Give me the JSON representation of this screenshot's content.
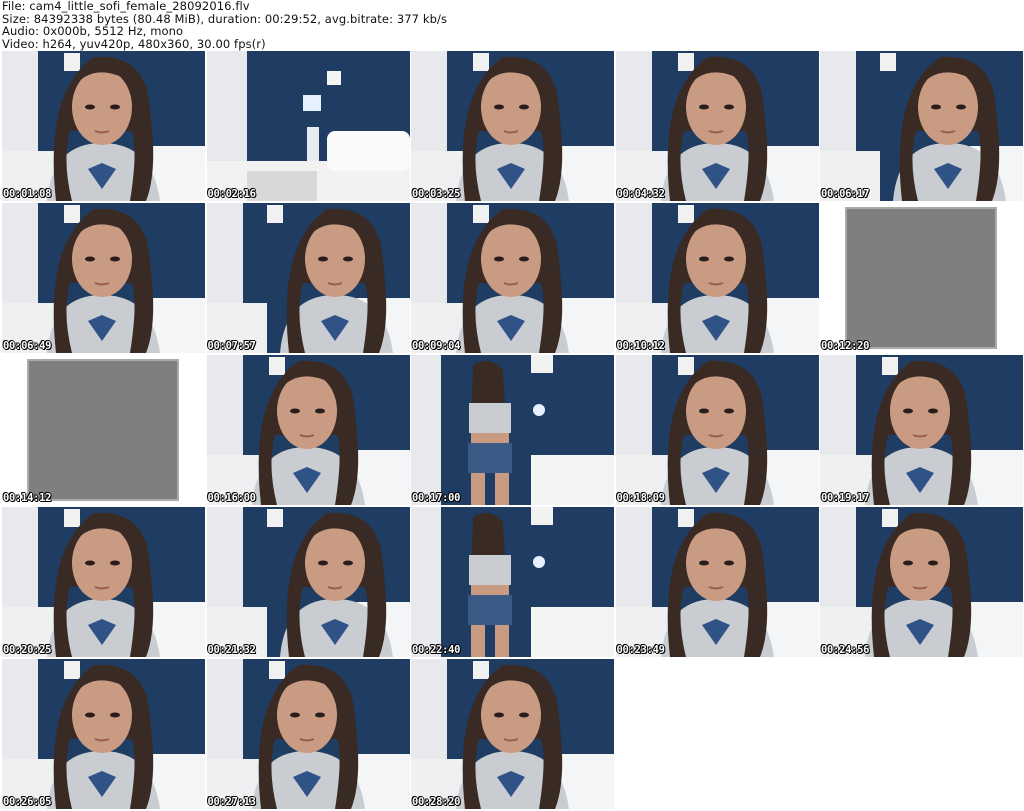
{
  "header": {
    "line1": "File: cam4_little_sofi_female_28092016.flv",
    "line2": "Size: 84392338 bytes (80.48 MiB), duration: 00:29:52, avg.bitrate: 377 kb/s",
    "line3": "Audio: 0x000b, 5512 Hz, mono",
    "line4": "Video: h264, yuv420p, 480x360, 30.00 fps(r)"
  },
  "thumbnails": [
    {
      "time": "00:01:08",
      "scene": "face"
    },
    {
      "time": "00:02:16",
      "scene": "room"
    },
    {
      "time": "00:03:25",
      "scene": "face"
    },
    {
      "time": "00:04:32",
      "scene": "face"
    },
    {
      "time": "00:06:17",
      "scene": "face-side"
    },
    {
      "time": "00:06:49",
      "scene": "face"
    },
    {
      "time": "00:07:57",
      "scene": "face-side"
    },
    {
      "time": "00:09:04",
      "scene": "face"
    },
    {
      "time": "00:10:12",
      "scene": "face"
    },
    {
      "time": "00:12:20",
      "scene": "gray"
    },
    {
      "time": "00:14:12",
      "scene": "gray"
    },
    {
      "time": "00:16:00",
      "scene": "face"
    },
    {
      "time": "00:17:00",
      "scene": "standing"
    },
    {
      "time": "00:18:09",
      "scene": "face"
    },
    {
      "time": "00:19:17",
      "scene": "face"
    },
    {
      "time": "00:20:25",
      "scene": "face"
    },
    {
      "time": "00:21:32",
      "scene": "face-side"
    },
    {
      "time": "00:22:40",
      "scene": "standing"
    },
    {
      "time": "00:23:49",
      "scene": "face"
    },
    {
      "time": "00:24:56",
      "scene": "face"
    },
    {
      "time": "00:26:05",
      "scene": "face"
    },
    {
      "time": "00:27:13",
      "scene": "face"
    },
    {
      "time": "00:28:20",
      "scene": "face"
    }
  ],
  "colors": {
    "wall": "#1f3d63",
    "curtain": "#e8e9ec",
    "shirt": "#c9ccd1",
    "hair": "#3a2a24",
    "skin": "#c99b82",
    "gray_frame": "#7f7f7f",
    "lamp": "#e6f0ff"
  }
}
